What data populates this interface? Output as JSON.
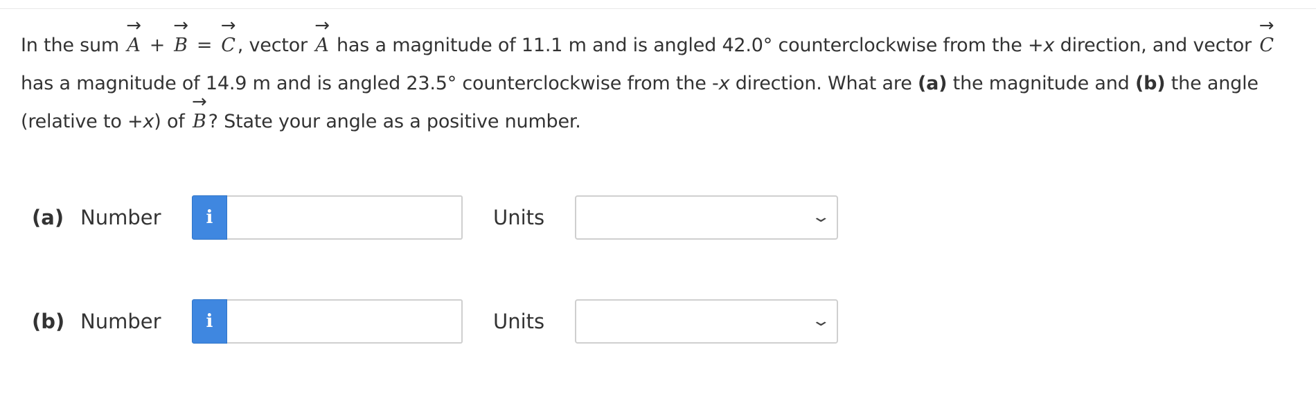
{
  "question": {
    "t1": "In the sum ",
    "vA": "A",
    "plus": "+",
    "vB": "B",
    "eq": "=",
    "vC": "C",
    "t2": ", vector ",
    "vA2": "A",
    "t3": " has a magnitude of 11.1 m and is angled 42.0° counterclockwise from the +",
    "x1": "x",
    "t4": " direction, and vector ",
    "vC2": "C",
    "t5": " has a magnitude of 14.9 m and is angled 23.5° counterclockwise from the -",
    "x2": "x",
    "t6": " direction. What are ",
    "pa": "(a)",
    "t7": " the magnitude and ",
    "pb": "(b)",
    "t8": " the angle (relative to +",
    "x3": "x",
    "t9": ") of ",
    "vB2": "B",
    "t10": "? State your angle as a positive number."
  },
  "parts": [
    {
      "label": "(a)",
      "number_label": "Number",
      "info_icon": "i",
      "value": "",
      "units_label": "Units",
      "units_value": ""
    },
    {
      "label": "(b)",
      "number_label": "Number",
      "info_icon": "i",
      "value": "",
      "units_label": "Units",
      "units_value": ""
    }
  ],
  "icons": {
    "info": "info-icon",
    "dropdown": "chevron-down-icon"
  },
  "colors": {
    "info_button": "#3f87e0",
    "text": "#333333",
    "border": "#cfcfcf"
  }
}
